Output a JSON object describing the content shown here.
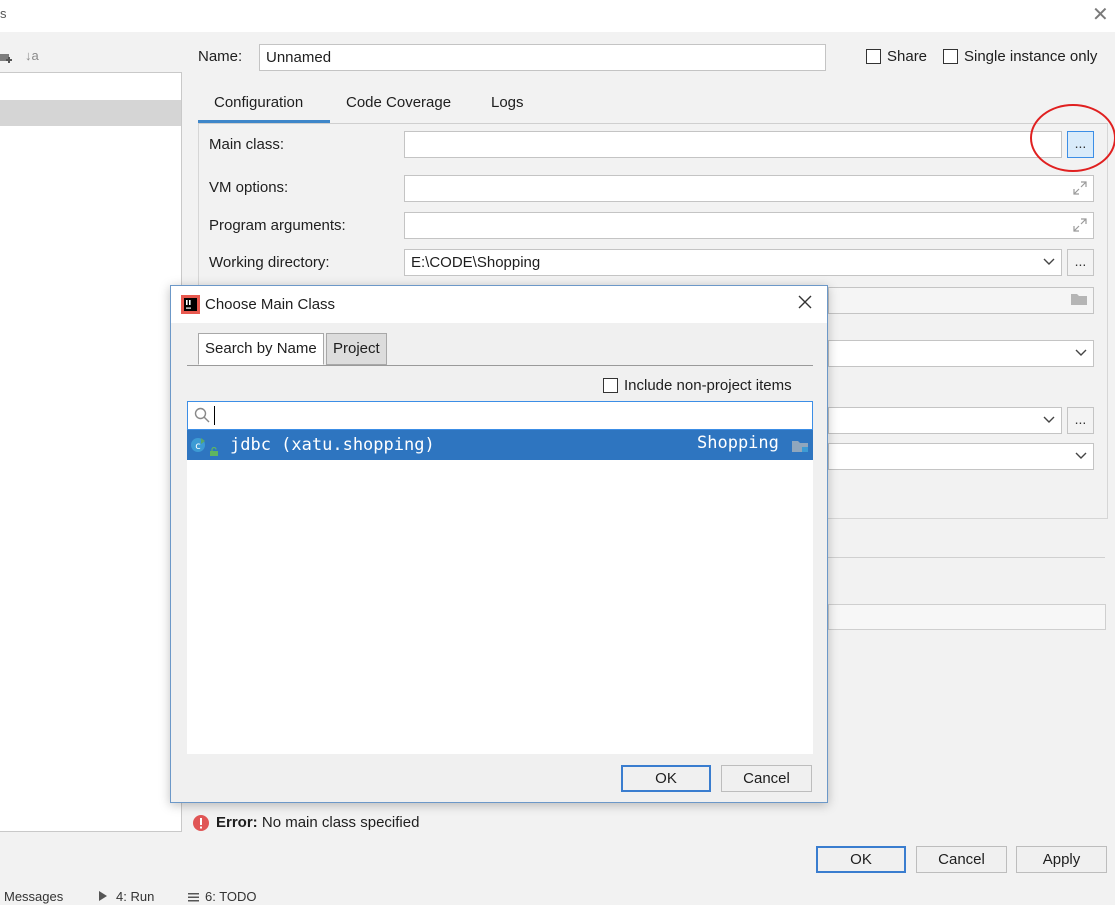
{
  "window": {
    "close_glyph": "✕",
    "title_fragment": "s"
  },
  "left_toolbar": {
    "icons": [
      "add-folder-icon",
      "sort-alphabetically-icon"
    ],
    "sort_glyph": "↓a"
  },
  "run_config": {
    "name_label": "Name:",
    "name_value": "Unnamed",
    "share_label": "Share",
    "single_instance_label": "Single instance only",
    "tabs": [
      {
        "label": "Configuration",
        "active": true
      },
      {
        "label": "Code Coverage",
        "active": false
      },
      {
        "label": "Logs",
        "active": false
      }
    ],
    "main_class_label": "Main class:",
    "main_class_value": "",
    "browse_glyph": "...",
    "vm_options_label": "VM options:",
    "program_args_label": "Program arguments:",
    "working_dir_label": "Working directory:",
    "working_dir_value": "E:\\CODE\\Shopping",
    "error_label": "Error:",
    "error_text": "No main class specified",
    "ok_label": "OK",
    "cancel_label": "Cancel",
    "apply_label": "Apply"
  },
  "dialog": {
    "title": "Choose Main Class",
    "tabs": [
      {
        "label": "Search by Name",
        "active": true
      },
      {
        "label": "Project",
        "active": false
      }
    ],
    "include_non_project_label": "Include non-project items",
    "search_value": "",
    "result": {
      "name": "jdbc (xatu.shopping)",
      "module": "Shopping"
    },
    "ok_label": "OK",
    "cancel_label": "Cancel"
  },
  "status_bar": {
    "items": [
      "Messages",
      "4: Run",
      "6: TODO"
    ]
  },
  "colors": {
    "selection": "#2e75c0",
    "accent": "#3e86c9",
    "error": "#e05555",
    "annotation_circle": "#e02020"
  }
}
